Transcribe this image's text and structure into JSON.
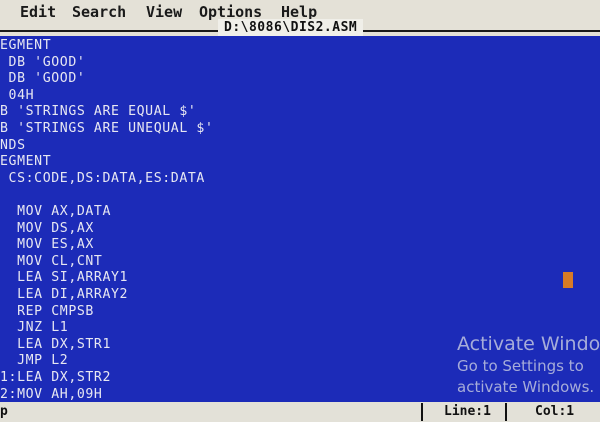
{
  "menu": {
    "items": [
      "Edit",
      "Search",
      "View",
      "Options",
      "Help"
    ]
  },
  "file_title": "D:\\8086\\DIS2.ASM",
  "editor": {
    "lines": [
      "EGMENT",
      " DB 'GOOD'",
      " DB 'GOOD'",
      " 04H",
      "B 'STRINGS ARE EQUAL $'",
      "B 'STRINGS ARE UNEQUAL $'",
      "NDS",
      "EGMENT",
      " CS:CODE,DS:DATA,ES:DATA",
      "",
      "  MOV AX,DATA",
      "  MOV DS,AX",
      "  MOV ES,AX",
      "  MOV CL,CNT",
      "  LEA SI,ARRAY1",
      "  LEA DI,ARRAY2",
      "  REP CMPSB",
      "  JNZ L1",
      "  LEA DX,STR1",
      "  JMP L2",
      "1:LEA DX,STR2",
      "2:MOV AH,09H"
    ]
  },
  "watermark": {
    "title": "Activate Windo",
    "line1": "Go to Settings to",
    "line2": "activate Windows."
  },
  "status": {
    "left": "p",
    "line": "Line:1",
    "col": "Col:1"
  },
  "colors": {
    "editor_bg": "#1c2bb8",
    "editor_text": "#e7e7f2",
    "cursor": "#d77b27",
    "menubar_bg": "#e4e1d7"
  }
}
